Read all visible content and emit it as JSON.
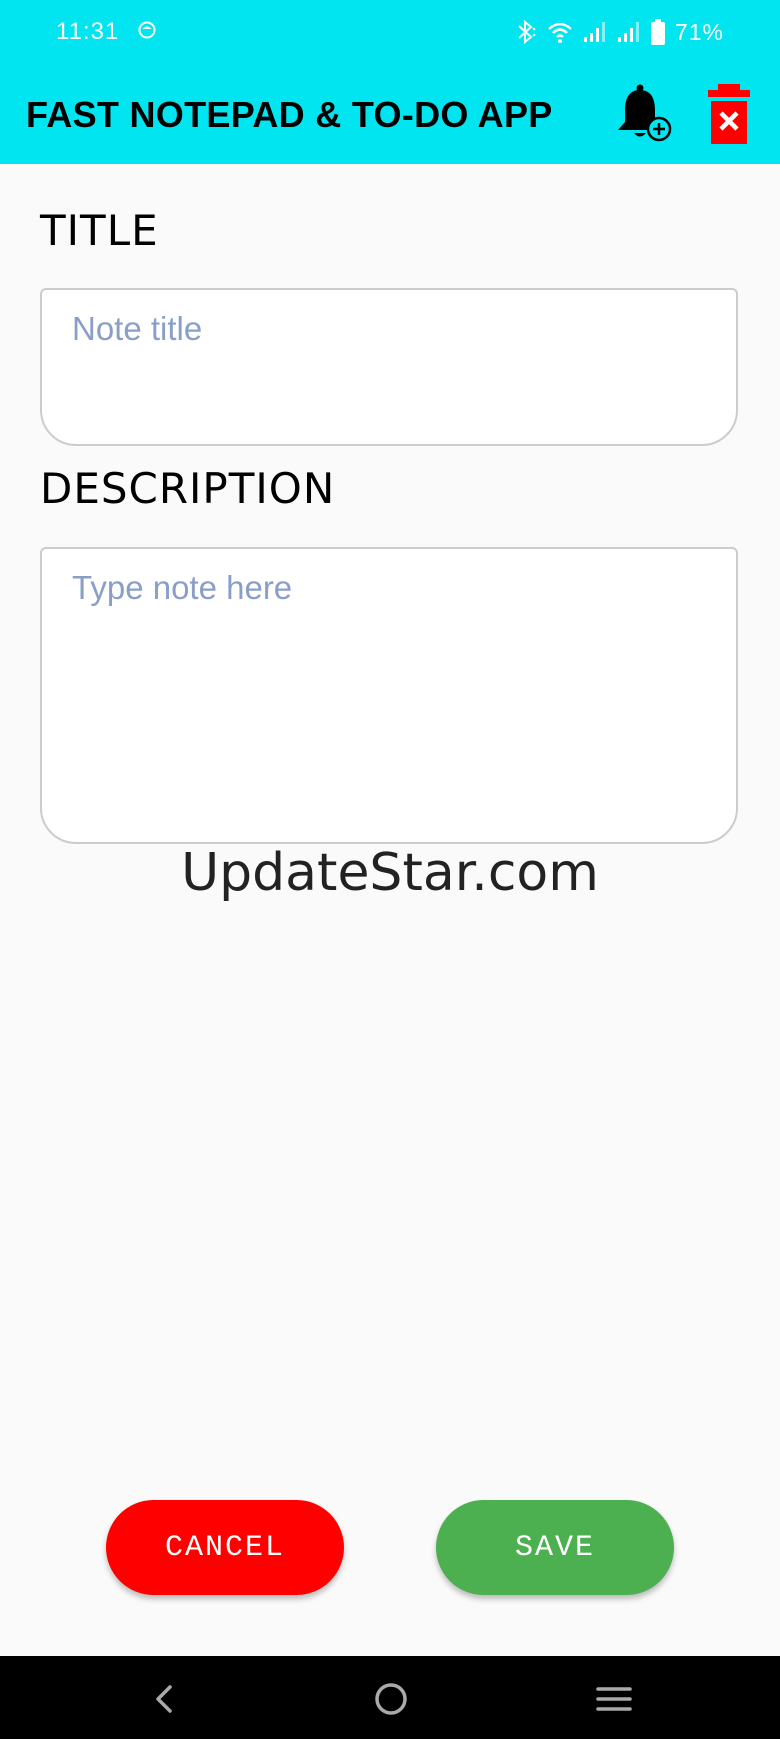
{
  "status_bar": {
    "time": "11:31",
    "battery": "71%",
    "icons": [
      "app-notification-icon",
      "bluetooth-icon",
      "wifi-icon",
      "signal-icon",
      "signal-icon",
      "battery-icon"
    ]
  },
  "app_bar": {
    "title": "FAST NOTEPAD & TO-DO APP",
    "background": "#00e5f0",
    "actions": [
      "bell-plus-icon",
      "delete-icon"
    ]
  },
  "form": {
    "title_label": "TITLE",
    "title_placeholder": "Note title",
    "title_value": "",
    "description_label": "DESCRIPTION",
    "description_placeholder": "Type note here",
    "description_value": ""
  },
  "watermark": "UpdateStar.com",
  "buttons": {
    "cancel_label": "CANCEL",
    "cancel_color": "#ff0000",
    "save_label": "SAVE",
    "save_color": "#4caf50"
  },
  "nav_bar": {
    "icons": [
      "back-icon",
      "home-icon",
      "recents-icon"
    ]
  }
}
